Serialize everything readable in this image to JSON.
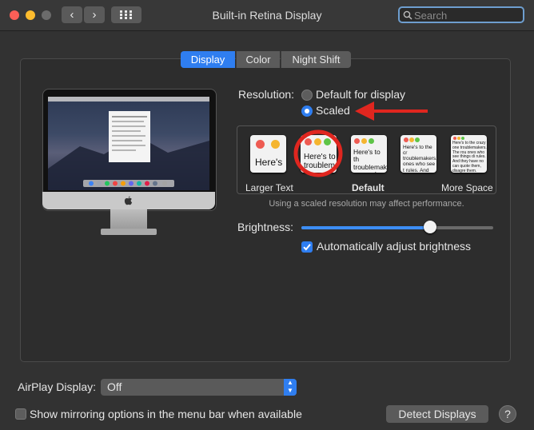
{
  "window": {
    "title": "Built-in Retina Display",
    "back_glyph": "‹",
    "forward_glyph": "›",
    "search_placeholder": "Search"
  },
  "tabs": [
    {
      "label": "Display",
      "selected": true
    },
    {
      "label": "Color",
      "selected": false
    },
    {
      "label": "Night Shift",
      "selected": false
    }
  ],
  "resolution": {
    "label": "Resolution:",
    "options": [
      {
        "label": "Default for display",
        "selected": false
      },
      {
        "label": "Scaled",
        "selected": true
      }
    ]
  },
  "scaled_thumbnails": [
    {
      "text": "Here's",
      "selected": false
    },
    {
      "text": "Here's to troublem",
      "selected": true
    },
    {
      "text": "Here's to th troublemak ones who se",
      "selected": false
    },
    {
      "text": "Here's to the cr troublemakers. ones who see t rules. And they",
      "selected": false
    },
    {
      "text": "Here's to the crazy one troublemakers. The rou ones who see things di rules. And they have no can quote them, disagre them. About the only th Because they change th",
      "selected": false
    }
  ],
  "scale_labels": {
    "left": "Larger Text",
    "center": "Default",
    "right": "More Space"
  },
  "scaled_note": "Using a scaled resolution may affect performance.",
  "brightness": {
    "label": "Brightness:",
    "level": 0.67
  },
  "auto_brightness": {
    "label": "Automatically adjust brightness",
    "checked": true
  },
  "airplay": {
    "label": "AirPlay Display:",
    "value": "Off"
  },
  "mirroring": {
    "label": "Show mirroring options in the menu bar when available",
    "checked": false
  },
  "detect_button": "Detect Displays",
  "help_glyph": "?",
  "colors": {
    "accent": "#3d8ef5",
    "annotation_red": "#e0261f"
  }
}
